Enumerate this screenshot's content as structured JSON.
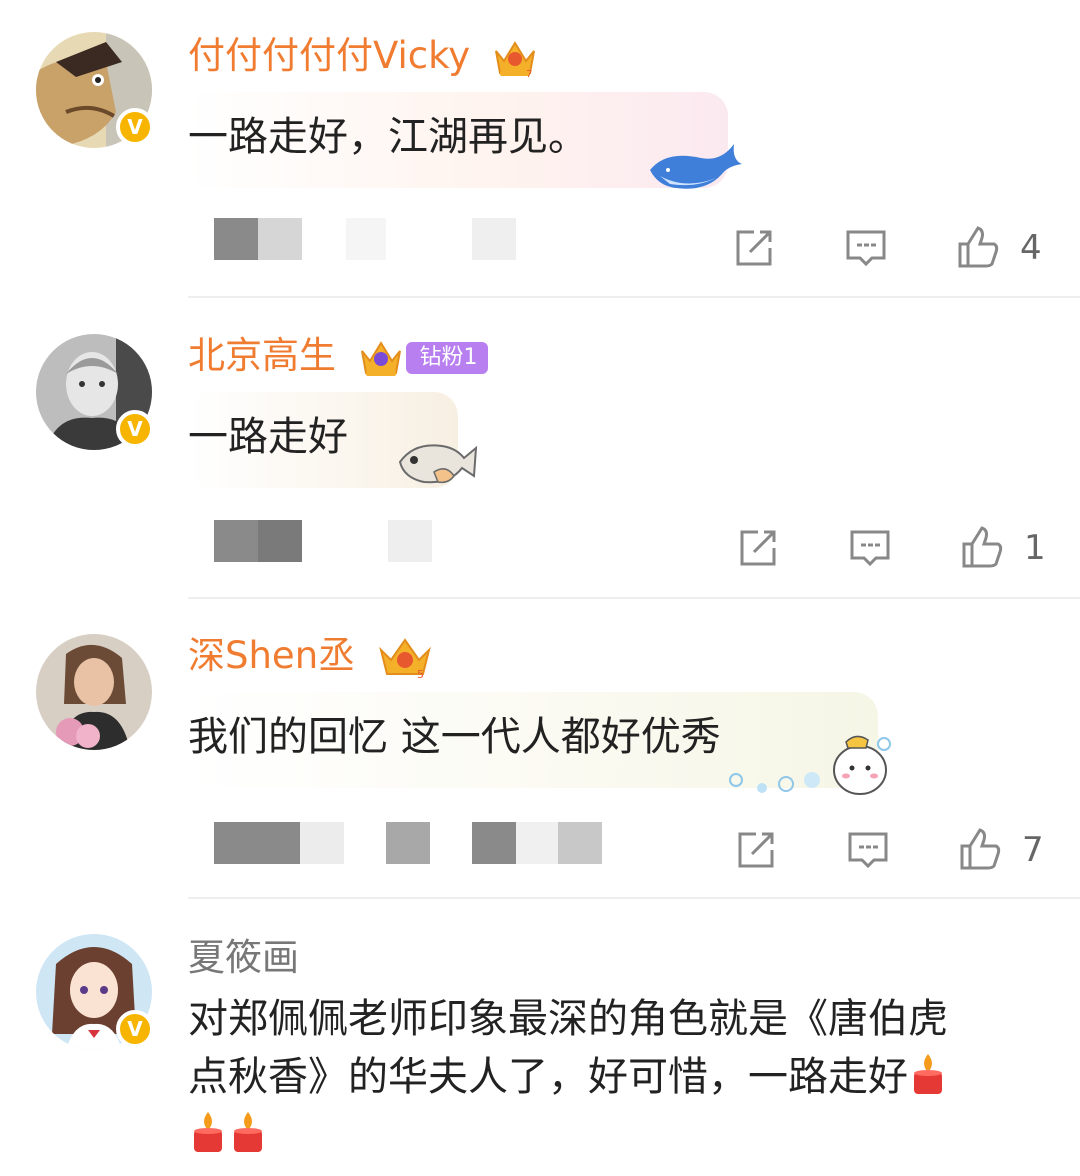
{
  "comments": [
    {
      "username": "付付付付付Vicky",
      "text": "一路走好，江湖再见。",
      "likes": "4",
      "username_color": "#f07c31",
      "sticker": "whale-sticker"
    },
    {
      "username": "北京高生",
      "fan_badge": "钻粉1",
      "text": "一路走好",
      "likes": "1",
      "username_color": "#f07c31",
      "sticker": "fish-sticker"
    },
    {
      "username": "深Shen丞",
      "text": "我们的回忆 这一代人都好优秀",
      "likes": "7",
      "username_color": "#f07c31",
      "sticker": "bubble-character-sticker"
    },
    {
      "username": "夏筱画",
      "text_line1": "对郑佩佩老师印象最深的角色就是《唐伯虎",
      "text_line2": "点秋香》的华夫人了，好可惜，一路走好",
      "username_color": "#777777",
      "emoji": "candle-emoji"
    }
  ],
  "icons": {
    "share": "share-icon",
    "reply": "comment-icon",
    "like": "thumbs-up-icon",
    "verified": "verified-v-badge",
    "crown": "crown-icon"
  },
  "verified_label": "V"
}
